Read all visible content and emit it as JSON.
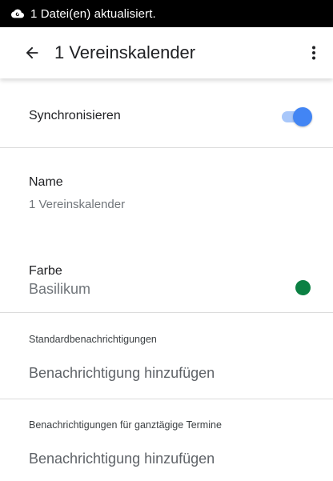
{
  "status_bar": {
    "icon": "cloud-sync-icon",
    "text": "1 Datei(en) aktualisiert."
  },
  "app_bar": {
    "back_icon": "arrow-back-icon",
    "title": "1 Vereinskalender",
    "more_icon": "more-vert-icon"
  },
  "sync": {
    "label": "Synchronisieren",
    "enabled": true,
    "accent_color": "#4285f4"
  },
  "name": {
    "label": "Name",
    "value": "1 Vereinskalender"
  },
  "color": {
    "label": "Farbe",
    "value": "Basilikum",
    "swatch": "#0b8043"
  },
  "default_notifications": {
    "header": "Standardbenachrichtigungen",
    "add_label": "Benachrichtigung hinzufügen"
  },
  "allday_notifications": {
    "header": "Benachrichtigungen für ganztägige Termine",
    "add_label": "Benachrichtigung hinzufügen"
  }
}
